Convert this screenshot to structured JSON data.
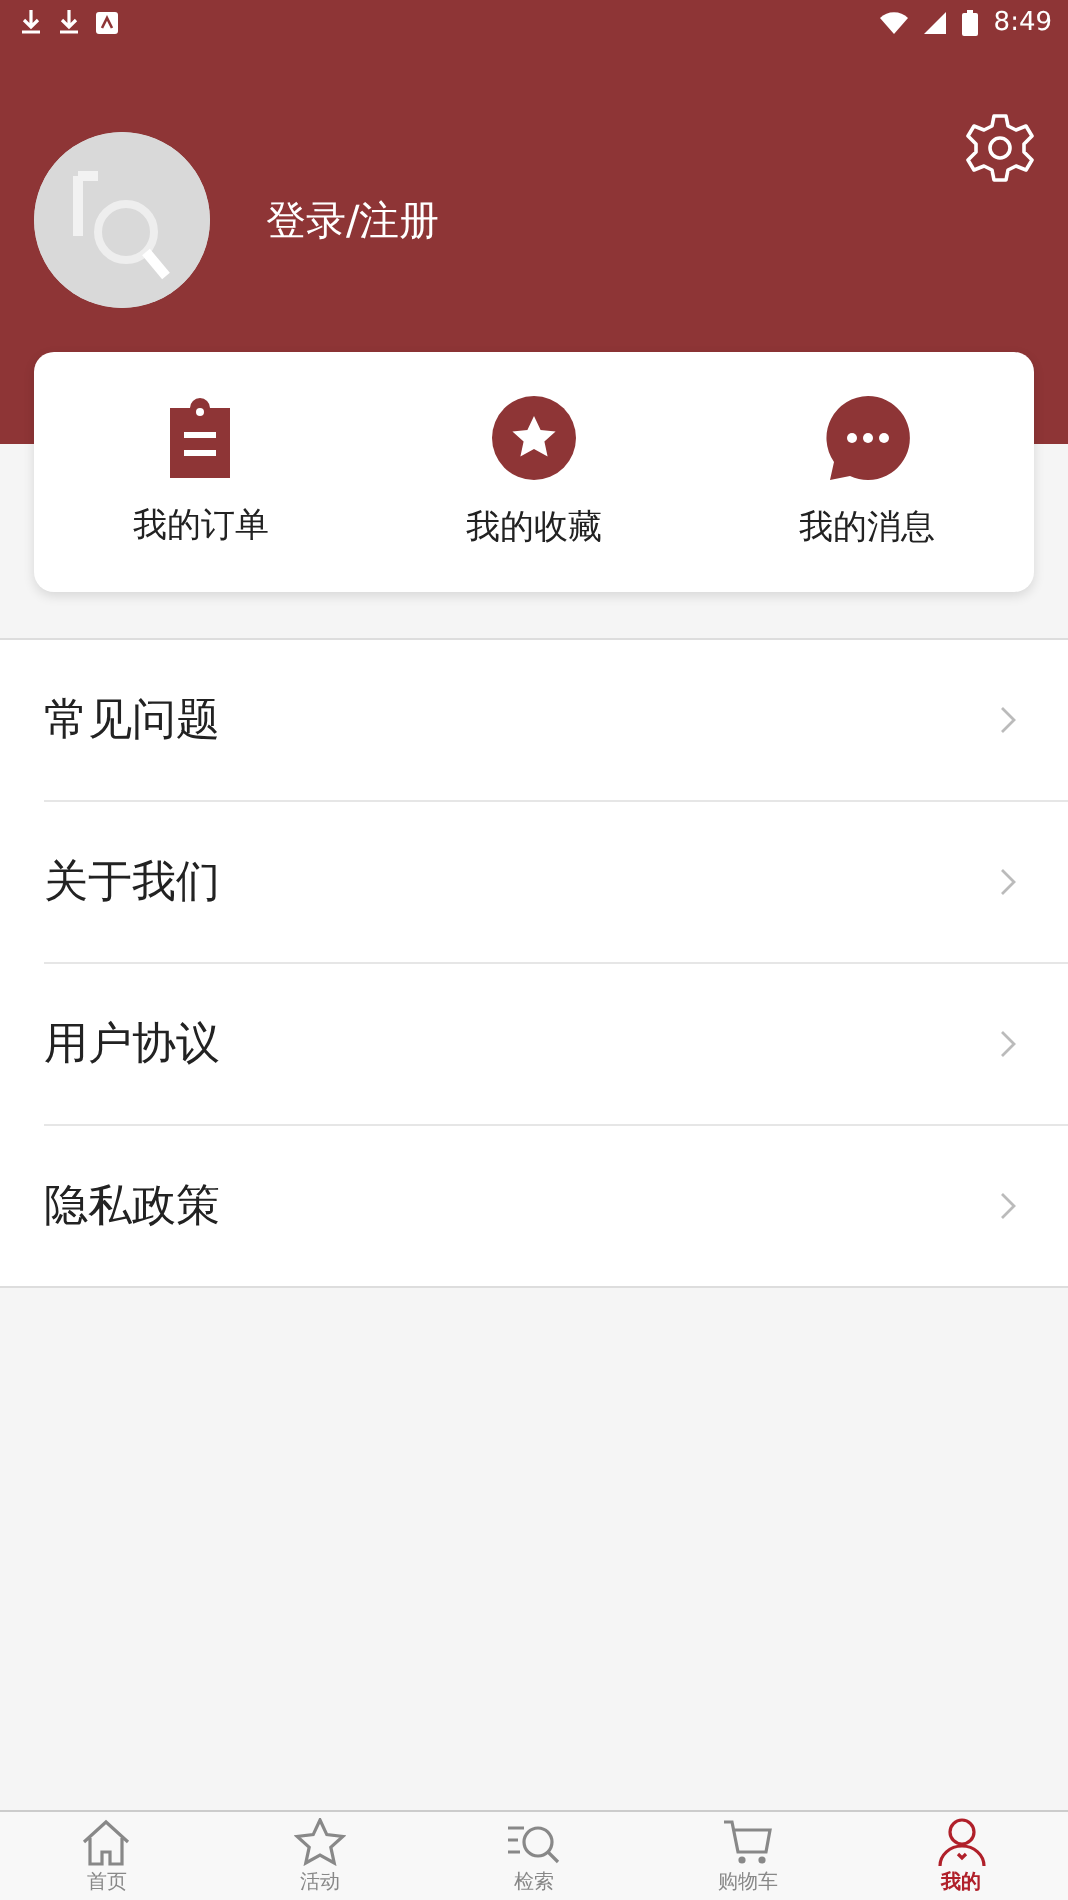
{
  "status_bar": {
    "time": "8:49"
  },
  "header": {
    "login_label": "登录/注册"
  },
  "shortcuts": [
    {
      "kind": "order",
      "label": "我的订单"
    },
    {
      "kind": "favorite",
      "label": "我的收藏"
    },
    {
      "kind": "message",
      "label": "我的消息"
    }
  ],
  "menu": [
    "常见问题",
    "关于我们",
    "用户协议",
    "隐私政策"
  ],
  "tab_bar": [
    {
      "kind": "home",
      "label": "首页",
      "selected": false
    },
    {
      "kind": "activity",
      "label": "活动",
      "selected": false
    },
    {
      "kind": "search",
      "label": "检索",
      "selected": false
    },
    {
      "kind": "cart",
      "label": "购物车",
      "selected": false
    },
    {
      "kind": "profile",
      "label": "我的",
      "selected": true
    }
  ]
}
